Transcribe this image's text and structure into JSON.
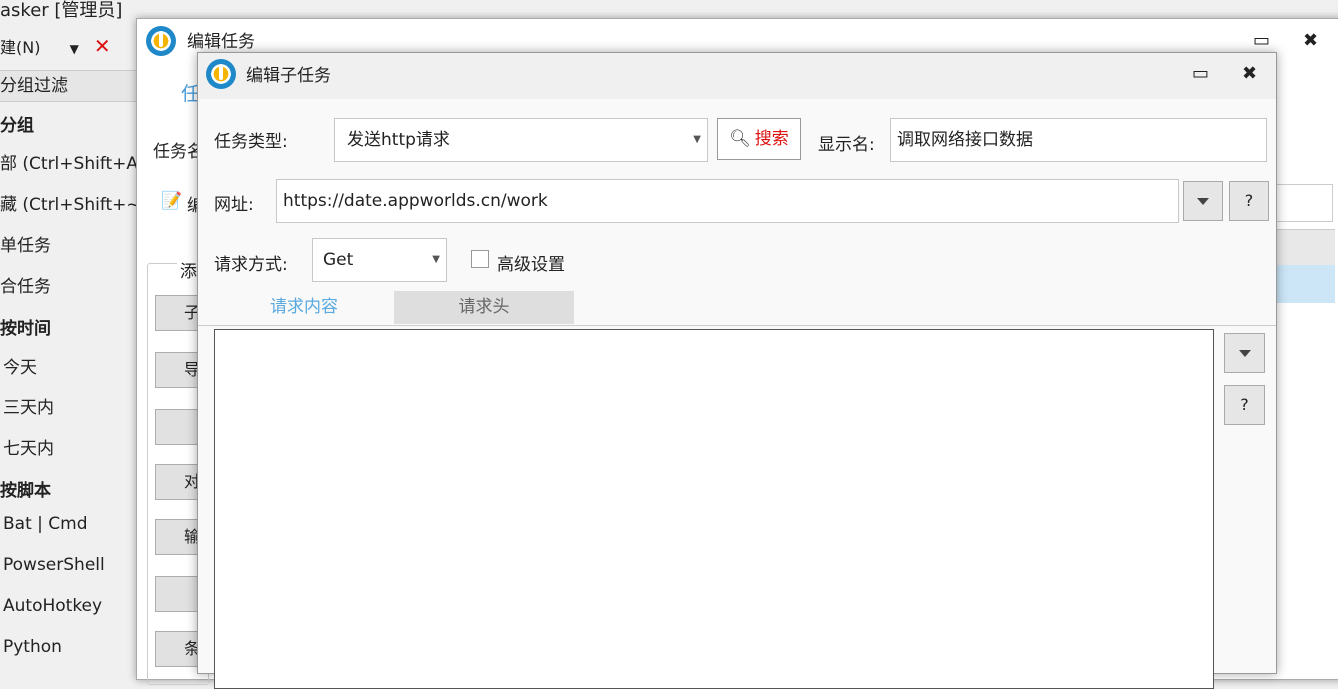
{
  "main_window": {
    "title": "asker [管理员]",
    "toolbar": {
      "new_label": "建(N)",
      "dropdown": "▼",
      "delete_icon": "✕",
      "trailing": "‖"
    },
    "filter_header": "分组过滤",
    "sidebar_items": [
      "分组",
      "部 (Ctrl+Shift+A)",
      "藏 (Ctrl+Shift+~)",
      "单任务",
      "合任务",
      "按时间",
      "今天",
      "三天内",
      "七天内",
      "按脚本",
      "Bat | Cmd",
      "PowserShell",
      "AutoHotkey",
      "Python"
    ]
  },
  "edit_task": {
    "title": "编辑任务",
    "tab_partial": "任",
    "name_label_partial": "任务名",
    "edit_partial": "编",
    "group_partial": "添",
    "side_buttons": [
      "子",
      "导",
      "",
      "对",
      "输",
      "",
      "条"
    ]
  },
  "edit_subtask": {
    "title": "编辑子任务",
    "task_type_label": "任务类型:",
    "task_type_value": "发送http请求",
    "search_label": "搜索",
    "display_name_label": "显示名:",
    "display_name_value": "调取网络接口数据",
    "url_label": "网址:",
    "url_value": "https://date.appworlds.cn/work",
    "help_label": "?",
    "method_label": "请求方式:",
    "method_value": "Get",
    "advanced_label": "高级设置",
    "tabs": [
      "请求内容",
      "请求头"
    ],
    "tab_active_color": "#5aa9df"
  }
}
